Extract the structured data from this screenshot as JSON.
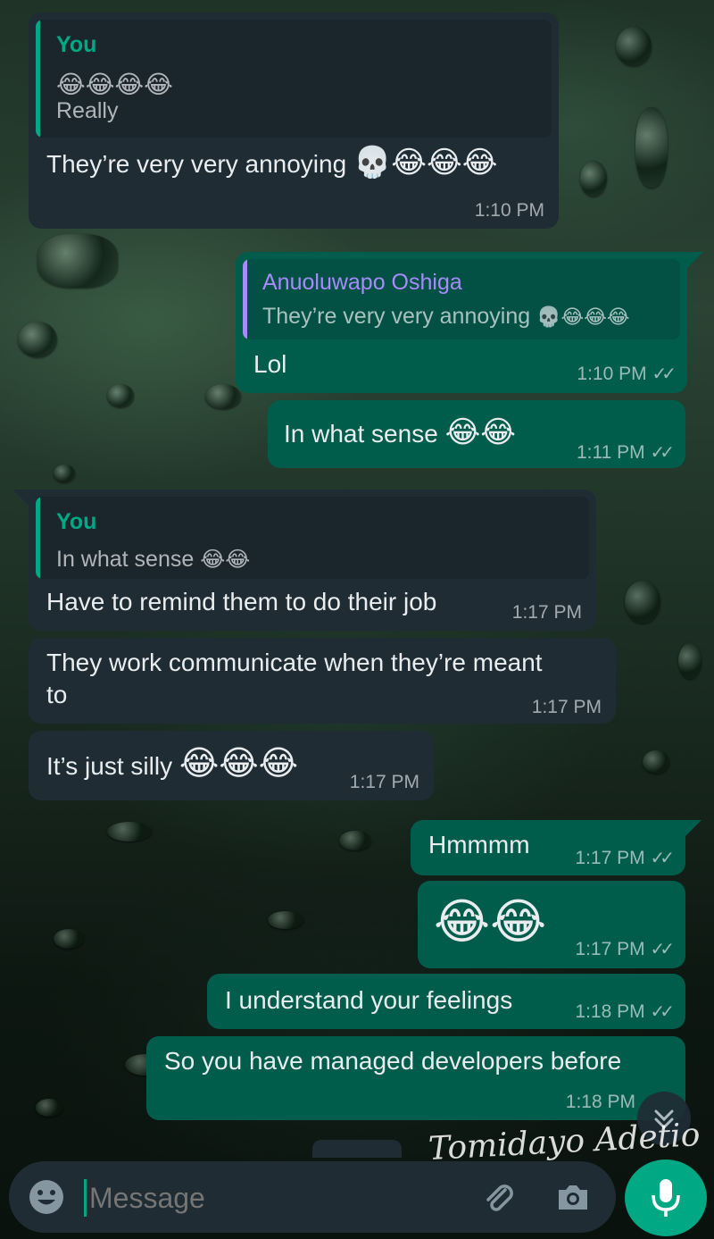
{
  "messages": [
    {
      "quote_author": "You",
      "quote_text_emoji": "😂😂😂😂",
      "quote_text": "Really",
      "text": "They’re very very annoying",
      "emoji": "💀😂😂😂",
      "time": "1:10 PM"
    },
    {
      "quote_author": "Anuoluwapo Oshiga",
      "quote_text": "They’re very very annoying",
      "quote_emoji": "💀😂😂😂",
      "text": "Lol",
      "time": "1:10 PM",
      "ticks": "✓✓"
    },
    {
      "text": "In what sense",
      "emoji": "😂😂",
      "time": "1:11 PM",
      "ticks": "✓✓"
    },
    {
      "quote_author": "You",
      "quote_text": "In what sense",
      "quote_emoji": "😂😂",
      "text": "Have to remind them to do their job",
      "time": "1:17 PM"
    },
    {
      "text_line1": "They work communicate when they’re meant",
      "text_line2": "to",
      "time": "1:17 PM"
    },
    {
      "text": "It’s just silly",
      "emoji": "😂😂😂",
      "time": "1:17 PM"
    },
    {
      "text": "Hmmmm",
      "time": "1:17 PM",
      "ticks": "✓✓"
    },
    {
      "emoji": "😂😂",
      "time": "1:17 PM",
      "ticks": "✓✓"
    },
    {
      "text": "I understand your feelings",
      "time": "1:18 PM",
      "ticks": "✓✓"
    },
    {
      "text": "So you have managed developers before",
      "time": "1:18 PM"
    }
  ],
  "signature": "Tomidayo Adetio",
  "input": {
    "placeholder": "Message",
    "emoji_icon": "emoji-icon",
    "attach_icon": "paperclip-icon",
    "camera_icon": "camera-icon",
    "mic_icon": "mic-icon"
  },
  "scroll_button_icon": "chevron-double-down-icon",
  "colors": {
    "incoming": "#1f2c34",
    "outgoing": "#005c4b",
    "quote_you": "#00a884",
    "quote_other": "#a78bfa",
    "mic": "#00a884"
  }
}
